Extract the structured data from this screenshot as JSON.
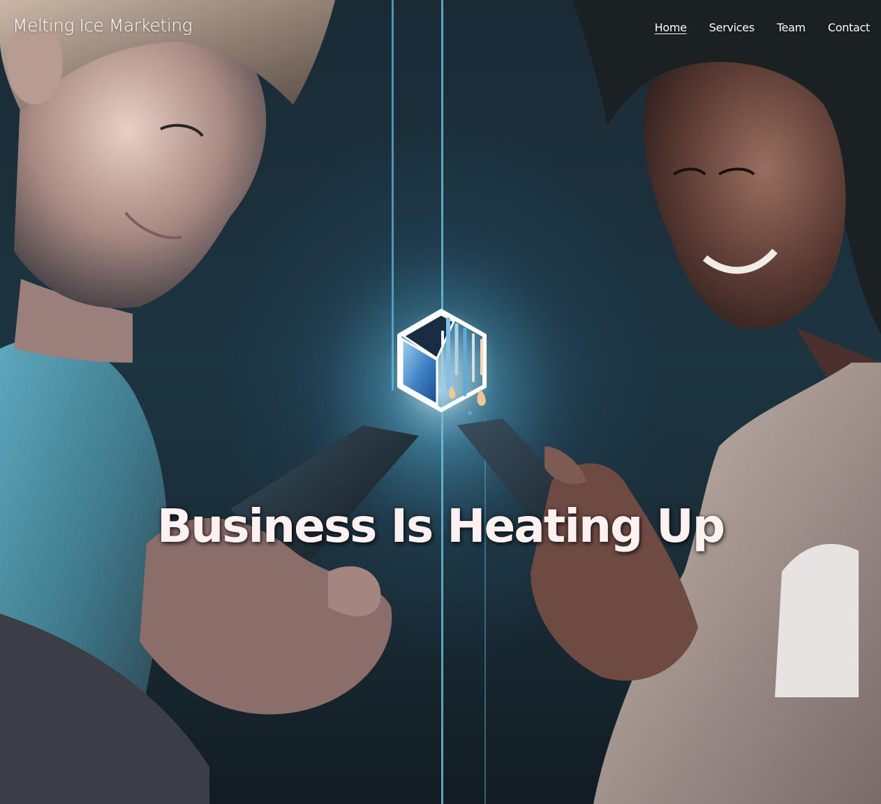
{
  "brand": {
    "name": "Melting Ice Marketing"
  },
  "nav": {
    "items": [
      {
        "label": "Home",
        "active": true
      },
      {
        "label": "Services",
        "active": false
      },
      {
        "label": "Team",
        "active": false
      },
      {
        "label": "Contact",
        "active": false
      }
    ]
  },
  "hero": {
    "headline": "Business Is Heating Up",
    "image_subject": "hero-photo-two-people-with-phones",
    "logo_icon": "melting-ice-cube-icon"
  },
  "colors": {
    "headline": "#fdf1f1",
    "nav_text": "#ffffff",
    "background": "#1d3441",
    "glow": "#3c8cb4"
  }
}
